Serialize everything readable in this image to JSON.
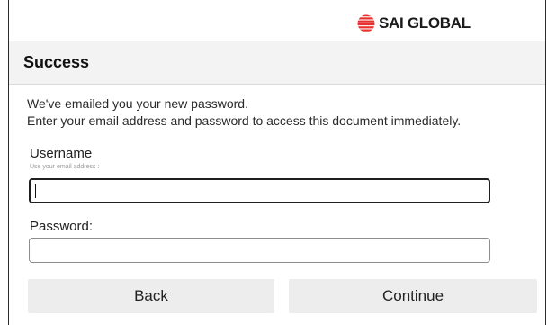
{
  "brand": {
    "name": "SAI GLOBAL",
    "logo_icon": "globe-stripes-icon",
    "accent_color": "#e8312f"
  },
  "header": {
    "title": "Success"
  },
  "message": {
    "line1": "We've emailed you your new password.",
    "line2": "Enter your email address and password to access this document immediately."
  },
  "form": {
    "username_label": "Username",
    "username_hint": "Use your email address :",
    "username_value": "",
    "password_label": "Password:",
    "password_value": ""
  },
  "actions": {
    "back_label": "Back",
    "continue_label": "Continue"
  }
}
